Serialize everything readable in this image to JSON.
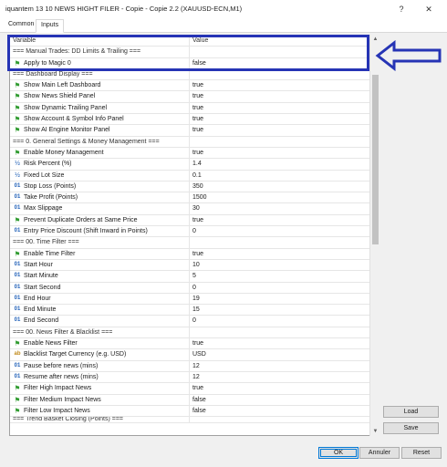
{
  "window": {
    "title": "iquantem 13 10 NEWS HIGHT FILER - Copie - Copie 2.2 (XAUUSD-ECN,M1)",
    "help_glyph": "?",
    "close_glyph": "✕"
  },
  "tabs": {
    "common": "Common",
    "inputs": "Inputs"
  },
  "grid": {
    "columns": {
      "variable": "Variable",
      "value": "Value"
    },
    "rows": [
      {
        "type": "section",
        "name": "=== Manual Trades: DD Limits & Trailing ===",
        "value": ""
      },
      {
        "type": "bool",
        "name": "Apply to Magic 0",
        "value": "false"
      },
      {
        "type": "section",
        "name": "=== Dashboard Display ===",
        "value": ""
      },
      {
        "type": "bool",
        "name": "Show Main Left Dashboard",
        "value": "true"
      },
      {
        "type": "bool",
        "name": "Show News Shield Panel",
        "value": "true"
      },
      {
        "type": "bool",
        "name": "Show Dynamic Trailing Panel",
        "value": "true"
      },
      {
        "type": "bool",
        "name": "Show Account & Symbol Info Panel",
        "value": "true"
      },
      {
        "type": "bool",
        "name": "Show AI Engine Monitor Panel",
        "value": "true"
      },
      {
        "type": "section",
        "name": "=== 0. General Settings & Money Management ===",
        "value": ""
      },
      {
        "type": "bool",
        "name": "Enable Money Management",
        "value": "true"
      },
      {
        "type": "dbl",
        "name": "Risk Percent (%)",
        "value": "1.4"
      },
      {
        "type": "dbl",
        "name": "Fixed Lot Size",
        "value": "0.1"
      },
      {
        "type": "num",
        "name": "Stop Loss (Points)",
        "value": "350"
      },
      {
        "type": "num",
        "name": "Take Profit (Points)",
        "value": "1500"
      },
      {
        "type": "num",
        "name": "Max Slippage",
        "value": "30"
      },
      {
        "type": "bool",
        "name": "Prevent Duplicate Orders at Same Price",
        "value": "true"
      },
      {
        "type": "num",
        "name": "Entry Price Discount (Shift Inward in Points)",
        "value": "0"
      },
      {
        "type": "section",
        "name": "=== 00. Time Filter ===",
        "value": ""
      },
      {
        "type": "bool",
        "name": "Enable Time Filter",
        "value": "true"
      },
      {
        "type": "num",
        "name": "Start Hour",
        "value": "10"
      },
      {
        "type": "num",
        "name": "Start Minute",
        "value": "5"
      },
      {
        "type": "num",
        "name": "Start Second",
        "value": "0"
      },
      {
        "type": "num",
        "name": "End Hour",
        "value": "19"
      },
      {
        "type": "num",
        "name": "End Minute",
        "value": "15"
      },
      {
        "type": "num",
        "name": "End Second",
        "value": "0"
      },
      {
        "type": "section",
        "name": "=== 00. News Filter & Blacklist ===",
        "value": ""
      },
      {
        "type": "bool",
        "name": "Enable News Filter",
        "value": "true"
      },
      {
        "type": "str",
        "name": "Blacklist Target Currency (e.g. USD)",
        "value": "USD"
      },
      {
        "type": "num",
        "name": "Pause before news (mins)",
        "value": "12"
      },
      {
        "type": "num",
        "name": "Resume after news (mins)",
        "value": "12"
      },
      {
        "type": "bool",
        "name": "Filter High Impact News",
        "value": "true"
      },
      {
        "type": "bool",
        "name": "Filter Medium Impact News",
        "value": "false"
      },
      {
        "type": "bool",
        "name": "Filter Low Impact News",
        "value": "false"
      },
      {
        "type": "section",
        "name": "=== Trend Basket Closing (Points) ===",
        "value": ""
      }
    ]
  },
  "icons": {
    "bool": "bool-flag-icon",
    "num": "integer-icon",
    "dbl": "fraction-icon",
    "str": "string-icon"
  },
  "icon_glyphs": {
    "bool": "⚑",
    "num": "01",
    "dbl": "½",
    "str": "ab"
  },
  "scroll": {
    "up_glyph": "▲",
    "down_glyph": "▼"
  },
  "buttons": {
    "load": "Load",
    "save": "Save",
    "ok": "OK",
    "annuler": "Annuler",
    "reset": "Reset"
  },
  "annotation": {
    "border_color": "#2634b5"
  }
}
